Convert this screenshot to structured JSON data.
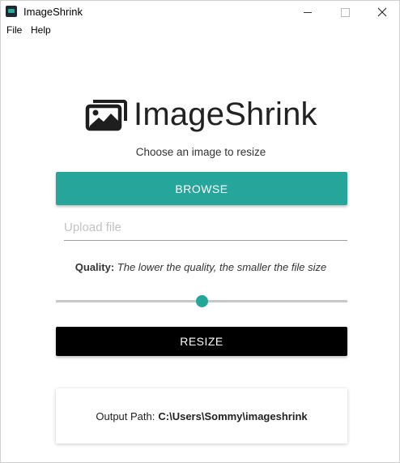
{
  "window": {
    "title": "ImageShrink",
    "controls": [
      "minimize",
      "maximize",
      "close"
    ]
  },
  "menu": {
    "items": [
      "File",
      "Help"
    ]
  },
  "header": {
    "logo_icon": "images-icon",
    "title": "ImageShrink",
    "subtitle": "Choose an image to resize"
  },
  "browse": {
    "label": "BROWSE",
    "color": "#26a69a"
  },
  "upload": {
    "placeholder": "Upload file",
    "value": ""
  },
  "quality": {
    "label": "Quality:",
    "hint": "The lower the quality, the smaller the file size",
    "value_fraction": 0.5
  },
  "resize": {
    "label": "RESIZE",
    "color": "#000000"
  },
  "output": {
    "label": "Output Path:",
    "path": "C:\\Users\\Sommy\\imageshrink"
  }
}
